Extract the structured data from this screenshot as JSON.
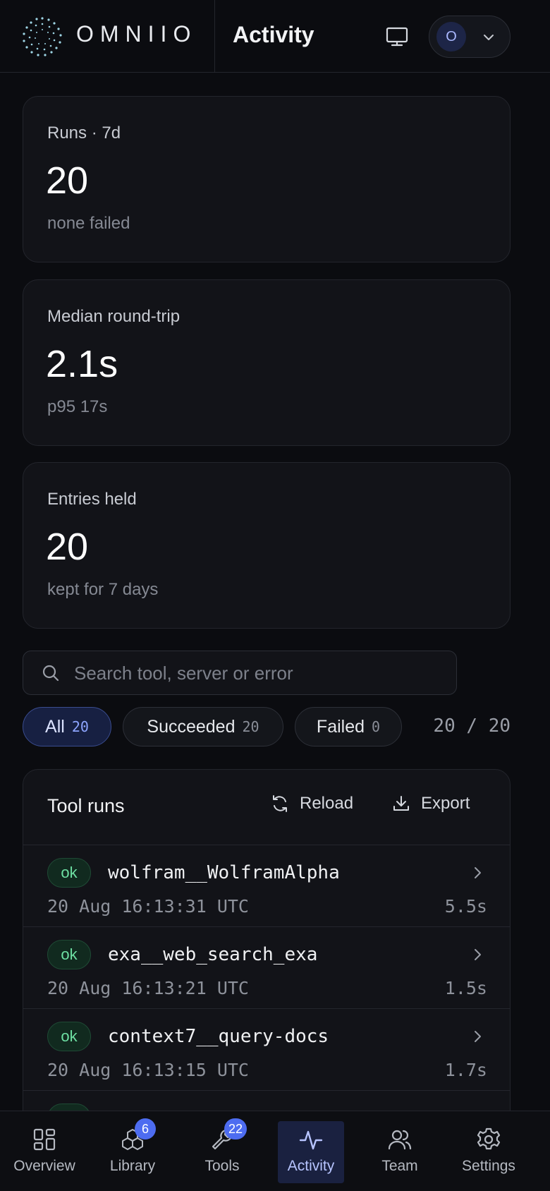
{
  "header": {
    "brand": "OMNIIO",
    "title": "Activity",
    "user_initial": "O",
    "icons": [
      "monitor-icon",
      "chevron-down-icon"
    ]
  },
  "stats": [
    {
      "label": "Runs · 7d",
      "value": "20",
      "sub": "none failed"
    },
    {
      "label": "Median round-trip",
      "value": "2.1s",
      "sub": "p95 17s"
    },
    {
      "label": "Entries held",
      "value": "20",
      "sub": "kept for 7 days"
    }
  ],
  "search": {
    "placeholder": "Search tool, server or error",
    "value": ""
  },
  "filters": [
    {
      "label": "All",
      "count": "20",
      "active": true
    },
    {
      "label": "Succeeded",
      "count": "20",
      "active": false
    },
    {
      "label": "Failed",
      "count": "0",
      "active": false
    }
  ],
  "counter": "20 / 20",
  "runs_panel": {
    "title": "Tool runs",
    "reload_label": "Reload",
    "export_label": "Export",
    "rows": [
      {
        "status": "ok",
        "tool": "wolfram__WolframAlpha",
        "timestamp": "20 Aug 16:13:31 UTC",
        "duration": "5.5s"
      },
      {
        "status": "ok",
        "tool": "exa__web_search_exa",
        "timestamp": "20 Aug 16:13:21 UTC",
        "duration": "1.5s"
      },
      {
        "status": "ok",
        "tool": "context7__query-docs",
        "timestamp": "20 Aug 16:13:15 UTC",
        "duration": "1.7s"
      },
      {
        "status": "ok",
        "tool": "",
        "timestamp": "",
        "duration": ""
      }
    ]
  },
  "nav": [
    {
      "label": "Overview",
      "icon": "grid-icon"
    },
    {
      "label": "Library",
      "icon": "boxes-icon",
      "badge": "6"
    },
    {
      "label": "Tools",
      "icon": "wrench-icon",
      "badge": "22"
    },
    {
      "label": "Activity",
      "icon": "activity-icon",
      "active": true
    },
    {
      "label": "Team",
      "icon": "users-icon"
    },
    {
      "label": "Settings",
      "icon": "gear-icon"
    }
  ],
  "colors": {
    "background": "#0b0c10",
    "card": "#121318",
    "accent": "#4d6cf0",
    "success": "#6ee0a3"
  }
}
